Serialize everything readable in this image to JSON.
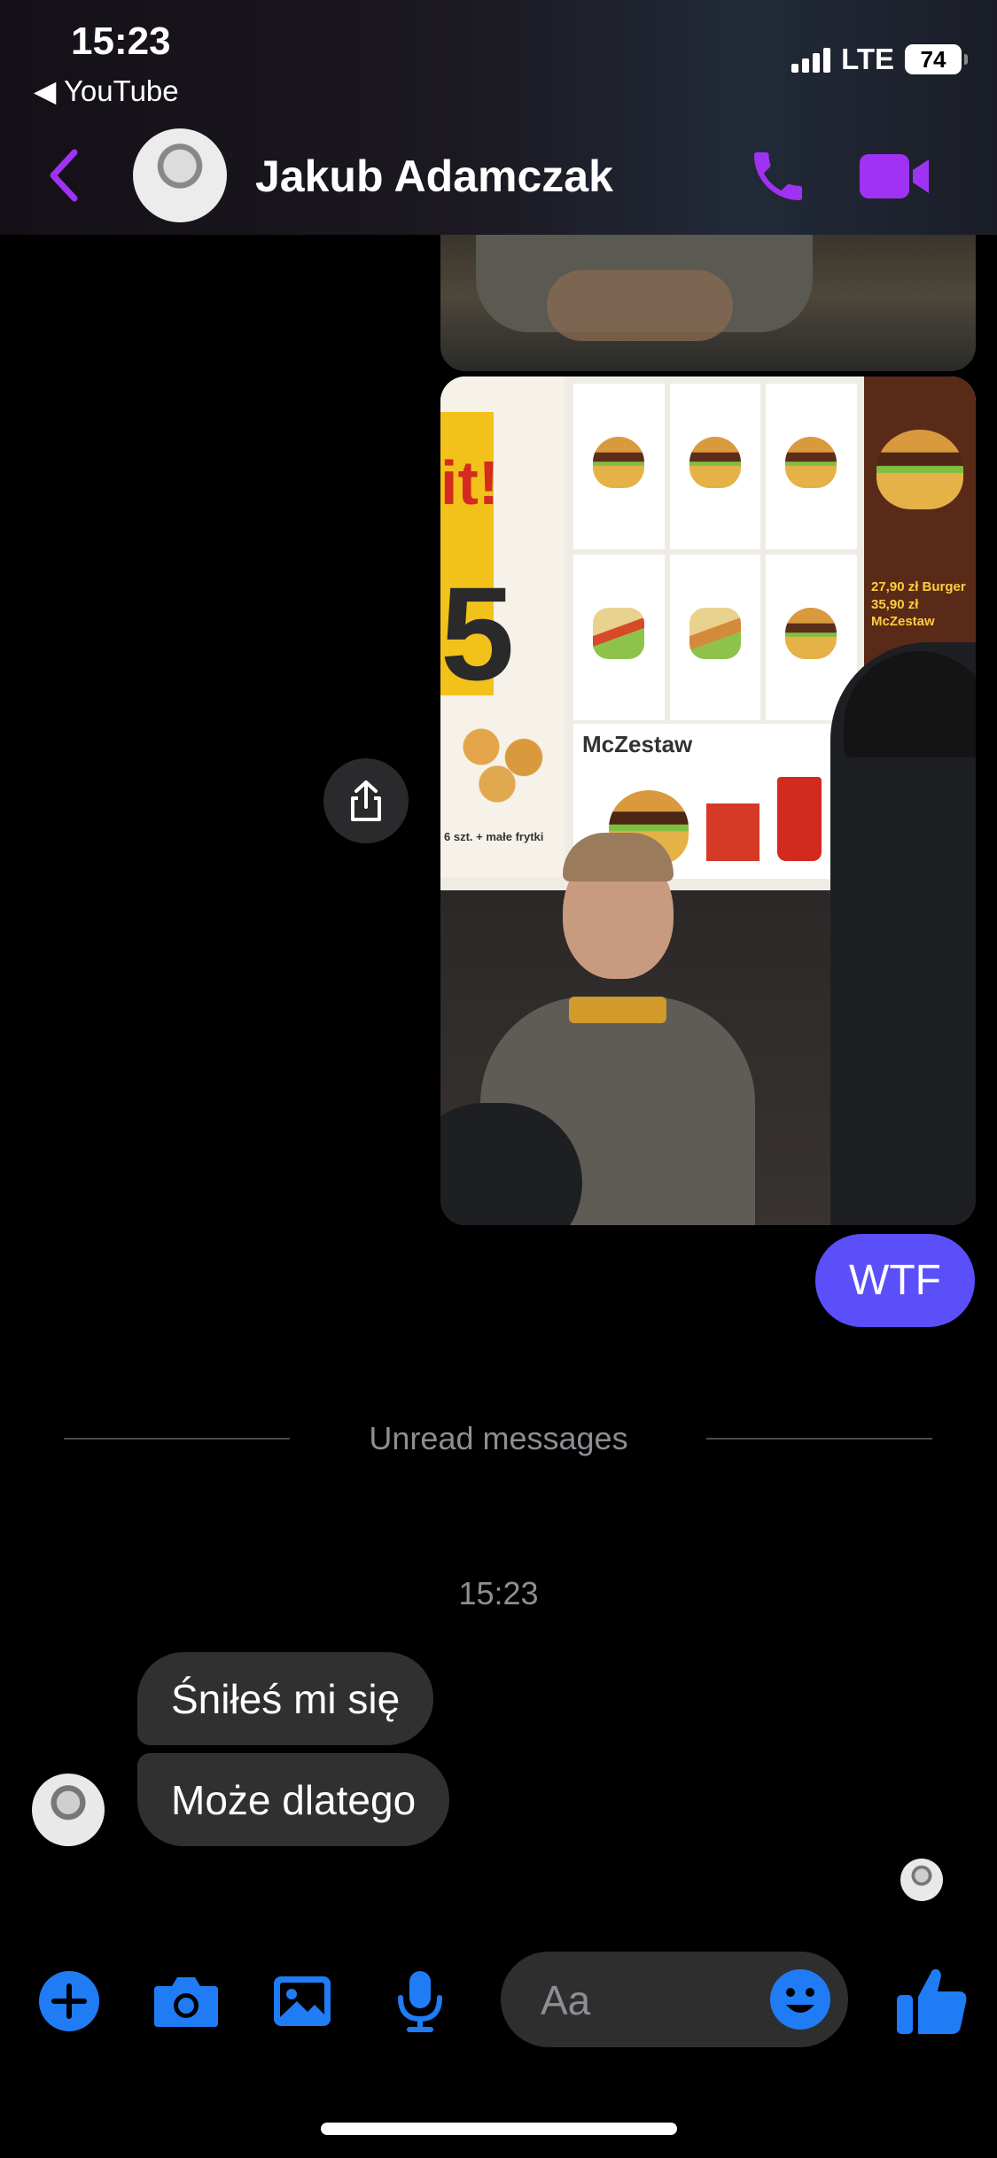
{
  "status_bar": {
    "time": "15:23",
    "back_app": "◀ YouTube",
    "network": "LTE",
    "battery": "74"
  },
  "header": {
    "contact_name": "Jakub Adamczak"
  },
  "messages": {
    "sent_text": "WTF",
    "unread_label": "Unread messages",
    "timestamp": "15:23",
    "received": [
      "Śniłeś mi się",
      "Może dlatego"
    ]
  },
  "photo": {
    "menu_big": "it!",
    "menu_price": "5",
    "menu_caption": "6 szt. + małe frytki",
    "mczestaw": "McZestaw",
    "promo_line1": "27,90 zł Burger",
    "promo_line2": "35,90 zł McZestaw"
  },
  "composer": {
    "placeholder": "Aa"
  },
  "colors": {
    "accent_purple": "#a033f3",
    "accent_blue": "#1f7cf5",
    "sent_bubble": "#5b4ffa",
    "received_bubble": "#303030"
  },
  "icons": [
    "back-chevron-icon",
    "phone-icon",
    "video-camera-icon",
    "share-icon",
    "plus-icon",
    "camera-icon",
    "gallery-icon",
    "microphone-icon",
    "emoji-icon",
    "thumbs-up-icon"
  ]
}
